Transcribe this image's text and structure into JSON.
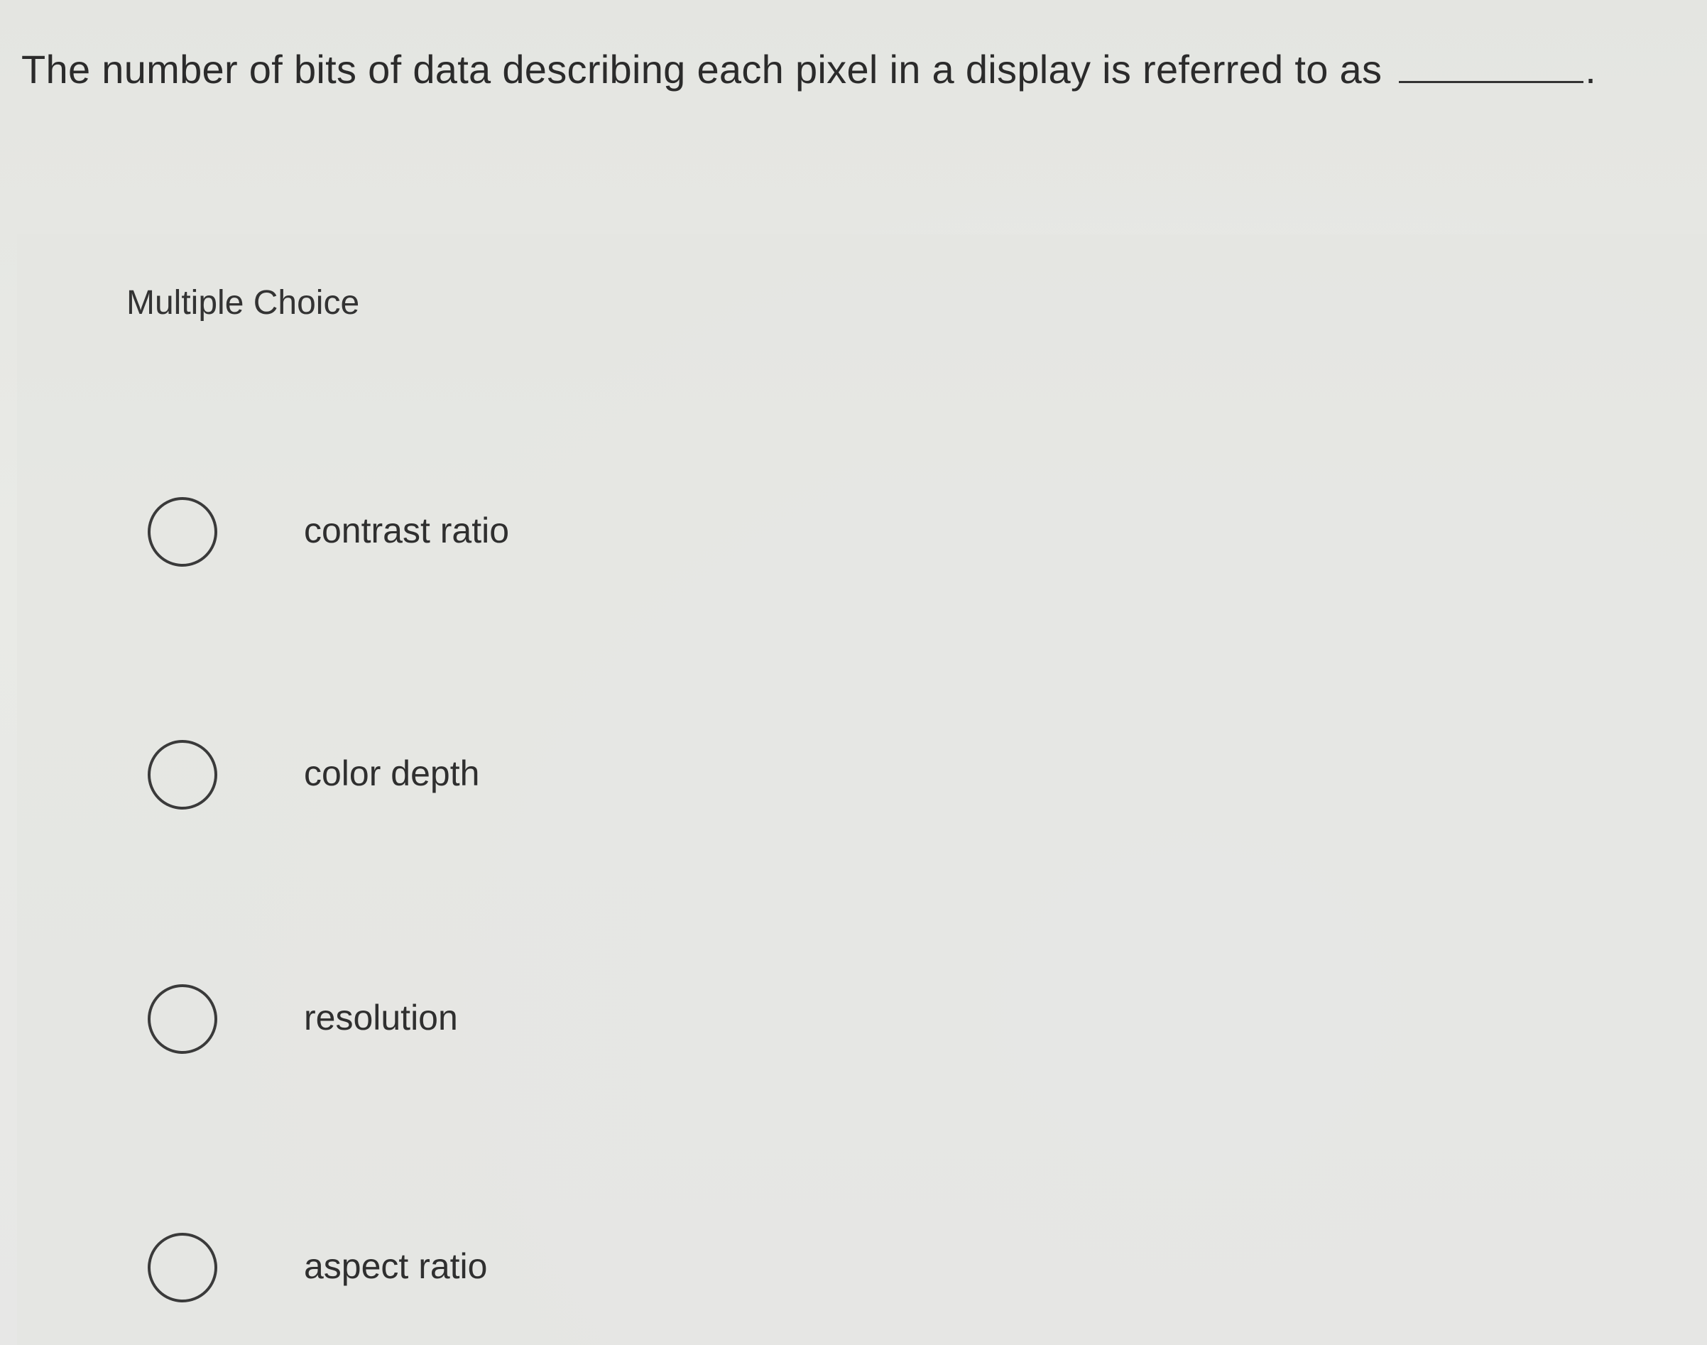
{
  "question": {
    "text": "The number of bits of data describing each pixel in a display is referred to as",
    "trailing_punctuation": "."
  },
  "section_label": "Multiple Choice",
  "options": [
    {
      "label": "contrast ratio",
      "selected": false
    },
    {
      "label": "color depth",
      "selected": false
    },
    {
      "label": "resolution",
      "selected": false
    },
    {
      "label": "aspect ratio",
      "selected": false
    }
  ]
}
